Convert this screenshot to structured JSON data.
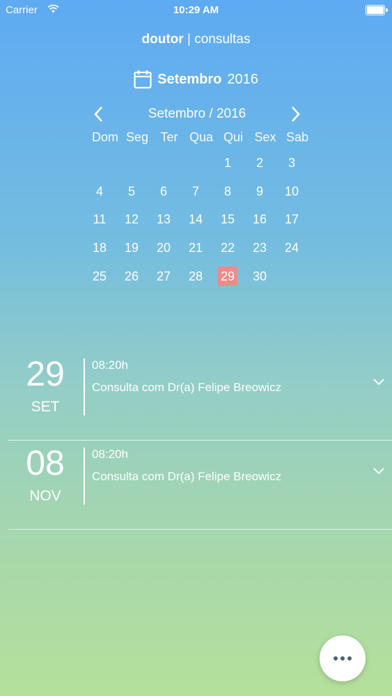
{
  "status": {
    "carrier": "Carrier",
    "time": "10:29 AM"
  },
  "header": {
    "brand": "doutor",
    "separator": "|",
    "section": "consultas"
  },
  "month_header": {
    "month": "Setembro",
    "year": "2016"
  },
  "calendar": {
    "nav_label": "Setembro / 2016",
    "weekdays": [
      "Dom",
      "Seg",
      "Ter",
      "Qua",
      "Qui",
      "Sex",
      "Sab"
    ],
    "weeks": [
      [
        "",
        "",
        "",
        "",
        "1",
        "2",
        "3"
      ],
      [
        "4",
        "5",
        "6",
        "7",
        "8",
        "9",
        "10"
      ],
      [
        "11",
        "12",
        "13",
        "14",
        "15",
        "16",
        "17"
      ],
      [
        "18",
        "19",
        "20",
        "21",
        "22",
        "23",
        "24"
      ],
      [
        "25",
        "26",
        "27",
        "28",
        "29",
        "30",
        ""
      ]
    ],
    "selected_day": "29",
    "selected_color": "#ef8a8a"
  },
  "appointments": [
    {
      "day": "29",
      "month": "SET",
      "time": "08:20h",
      "description": "Consulta com Dr(a) Felipe Breowicz"
    },
    {
      "day": "08",
      "month": "NOV",
      "time": "08:20h",
      "description": "Consulta com Dr(a) Felipe Breowicz"
    }
  ],
  "icons": {
    "calendar": "calendar-icon",
    "prev": "chevron-left-icon",
    "next": "chevron-right-icon",
    "expand": "chevron-down-icon",
    "more": "more-dots-icon"
  }
}
